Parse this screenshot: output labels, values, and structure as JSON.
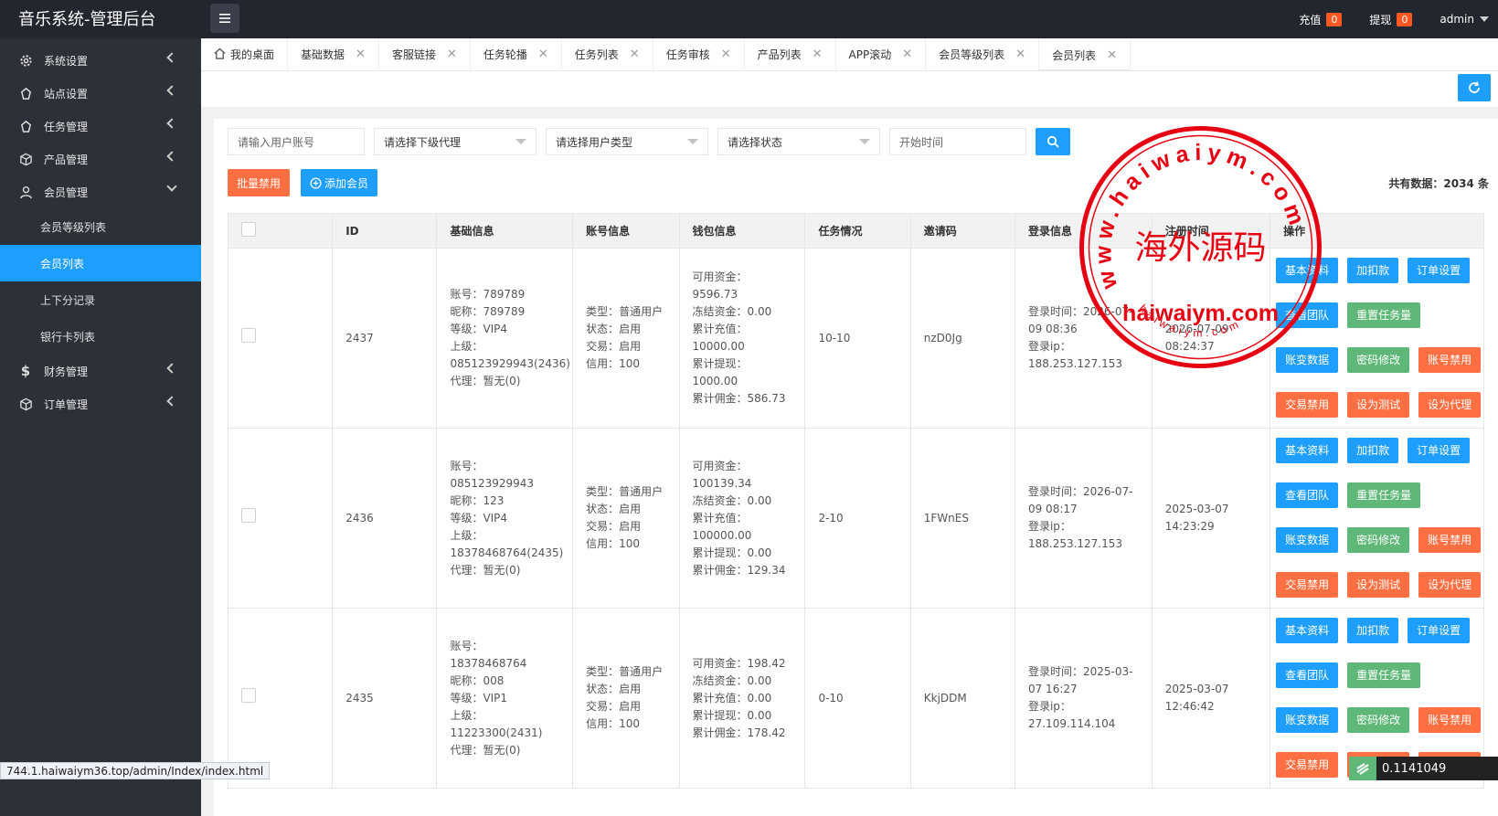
{
  "topbar": {
    "brand": "音乐系统-管理后台",
    "recharge_label": "充值",
    "recharge_count": "0",
    "withdraw_label": "提现",
    "withdraw_count": "0",
    "admin": "admin"
  },
  "sidebar": {
    "items": [
      {
        "label": "系统设置",
        "icon": "gear-icon"
      },
      {
        "label": "站点设置",
        "icon": "site-icon"
      },
      {
        "label": "任务管理",
        "icon": "task-icon"
      },
      {
        "label": "产品管理",
        "icon": "cube-icon"
      },
      {
        "label": "会员管理",
        "icon": "user-icon"
      },
      {
        "label": "财务管理",
        "icon": "dollar-icon"
      },
      {
        "label": "订单管理",
        "icon": "order-icon"
      }
    ],
    "member_sub": [
      "会员等级列表",
      "会员列表",
      "上下分记录",
      "银行卡列表"
    ]
  },
  "tabs": [
    "我的桌面",
    "基础数据",
    "客服链接",
    "任务轮播",
    "任务列表",
    "任务审核",
    "产品列表",
    "APP滚动",
    "会员等级列表",
    "会员列表"
  ],
  "filters": {
    "account_placeholder": "请输入用户账号",
    "agent_select": "请选择下级代理",
    "type_select": "请选择用户类型",
    "status_select": "请选择状态",
    "start_placeholder": "开始时间"
  },
  "actions": {
    "batch_ban": "批量禁用",
    "add_member": "添加会员",
    "total": "共有数据：2034 条"
  },
  "table": {
    "headers": [
      "ID",
      "基础信息",
      "账号信息",
      "钱包信息",
      "任务情况",
      "邀请码",
      "登录信息",
      "注册时间",
      "操作"
    ],
    "rows": [
      {
        "id": "2437",
        "basic": [
          "账号：789789",
          "昵称：789789",
          "等级：VIP4",
          "上级：085123929943(2436)",
          "代理：暂无(0)"
        ],
        "account": [
          "类型：普通用户",
          "状态：启用",
          "交易：启用",
          "信用：100"
        ],
        "wallet": [
          "可用资金：9596.73",
          "冻结资金：0.00",
          "累计充值：10000.00",
          "累计提现：1000.00",
          "累计佣金：586.73"
        ],
        "task": "10-10",
        "invite": "nzD0Jg",
        "login": [
          "登录时间：2026-07-09 08:36",
          "登录ip：188.253.127.153"
        ],
        "reg": "2026-07-09 08:24:37"
      },
      {
        "id": "2436",
        "basic": [
          "账号：085123929943",
          "昵称：123",
          "等级：VIP4",
          "上级：18378468764(2435)",
          "代理：暂无(0)"
        ],
        "account": [
          "类型：普通用户",
          "状态：启用",
          "交易：启用",
          "信用：100"
        ],
        "wallet": [
          "可用资金：100139.34",
          "冻结资金：0.00",
          "累计充值：100000.00",
          "累计提现：0.00",
          "累计佣金：129.34"
        ],
        "task": "2-10",
        "invite": "1FWnES",
        "login": [
          "登录时间：2026-07-09 08:17",
          "登录ip：188.253.127.153"
        ],
        "reg": "2025-03-07 14:23:29"
      },
      {
        "id": "2435",
        "basic": [
          "账号：18378468764",
          "昵称：008",
          "等级：VIP1",
          "上级：11223300(2431)",
          "代理：暂无(0)"
        ],
        "account": [
          "类型：普通用户",
          "状态：启用",
          "交易：启用",
          "信用：100"
        ],
        "wallet": [
          "可用资金：198.42",
          "冻结资金：0.00",
          "累计充值：0.00",
          "累计提现：0.00",
          "累计佣金：178.42"
        ],
        "task": "0-10",
        "invite": "KkjDDM",
        "login": [
          "登录时间：2025-03-07 16:27",
          "登录ip：27.109.114.104"
        ],
        "reg": "2025-03-07 12:46:42"
      }
    ],
    "ops": [
      {
        "label": "基本资料",
        "color": "blue"
      },
      {
        "label": "加扣款",
        "color": "blue"
      },
      {
        "label": "订单设置",
        "color": "blue"
      },
      {
        "label": "查看团队",
        "color": "blue"
      },
      {
        "label": "重置任务量",
        "color": "green"
      },
      {
        "label": "账变数据",
        "color": "blue"
      },
      {
        "label": "密码修改",
        "color": "green"
      },
      {
        "label": "账号禁用",
        "color": "red"
      },
      {
        "label": "交易禁用",
        "color": "red"
      },
      {
        "label": "设为测试",
        "color": "red"
      },
      {
        "label": "设为代理",
        "color": "red"
      }
    ]
  },
  "watermark": {
    "cn": "海外源码",
    "domain": "haiwaiym.com",
    "ring": "www.haiwaiym.com",
    "small": "haiwaiym.com"
  },
  "statusbar": "744.1.haiwaiym36.top/admin/Index/index.html",
  "corner_value": "0.1141049",
  "colors": {
    "primary": "#1e9fff",
    "green": "#5fb878",
    "danger": "#ff5722",
    "sidebar": "#2c3038",
    "watermark": "#e60012"
  }
}
